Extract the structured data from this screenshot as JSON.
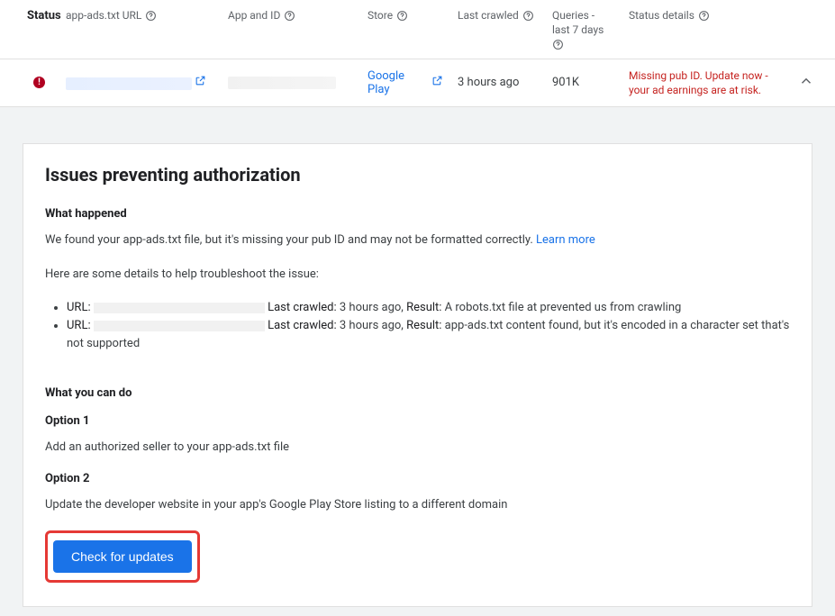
{
  "columns": {
    "status": "Status",
    "url": "app-ads.txt URL",
    "app": "App and ID",
    "store": "Store",
    "crawl": "Last crawled",
    "queries": "Queries - last 7 days",
    "sdetails": "Status details"
  },
  "row": {
    "store": "Google Play",
    "lastCrawled": "3 hours ago",
    "queries": "901K",
    "statusDetails": "Missing pub ID. Update now - your ad earnings are at risk."
  },
  "panel": {
    "title": "Issues preventing authorization",
    "whatHappened": "What happened",
    "intro1": "We found your app-ads.txt file, but it's missing your pub ID and may not be formatted correctly. ",
    "learnMore": "Learn more",
    "intro2": "Here are some details to help troubleshoot the issue:",
    "items": [
      {
        "urlLabel": "URL:",
        "lastCrawledLabel": "Last crawled:",
        "lastCrawled": "3 hours ago",
        "resultLabel": "Result:",
        "result": "A robots.txt file at prevented us from crawling"
      },
      {
        "urlLabel": "URL:",
        "lastCrawledLabel": "Last crawled:",
        "lastCrawled": "3 hours ago",
        "resultLabel": "Result:",
        "result": "app-ads.txt content found, but it's encoded in a character set that's not supported"
      }
    ],
    "whatYouCanDo": "What you can do",
    "opt1": "Option 1",
    "opt1Text": "Add an authorized seller to your app-ads.txt file",
    "opt2": "Option 2",
    "opt2Text": "Update the developer website in your app's Google Play Store listing to a different domain",
    "button": "Check for updates"
  }
}
